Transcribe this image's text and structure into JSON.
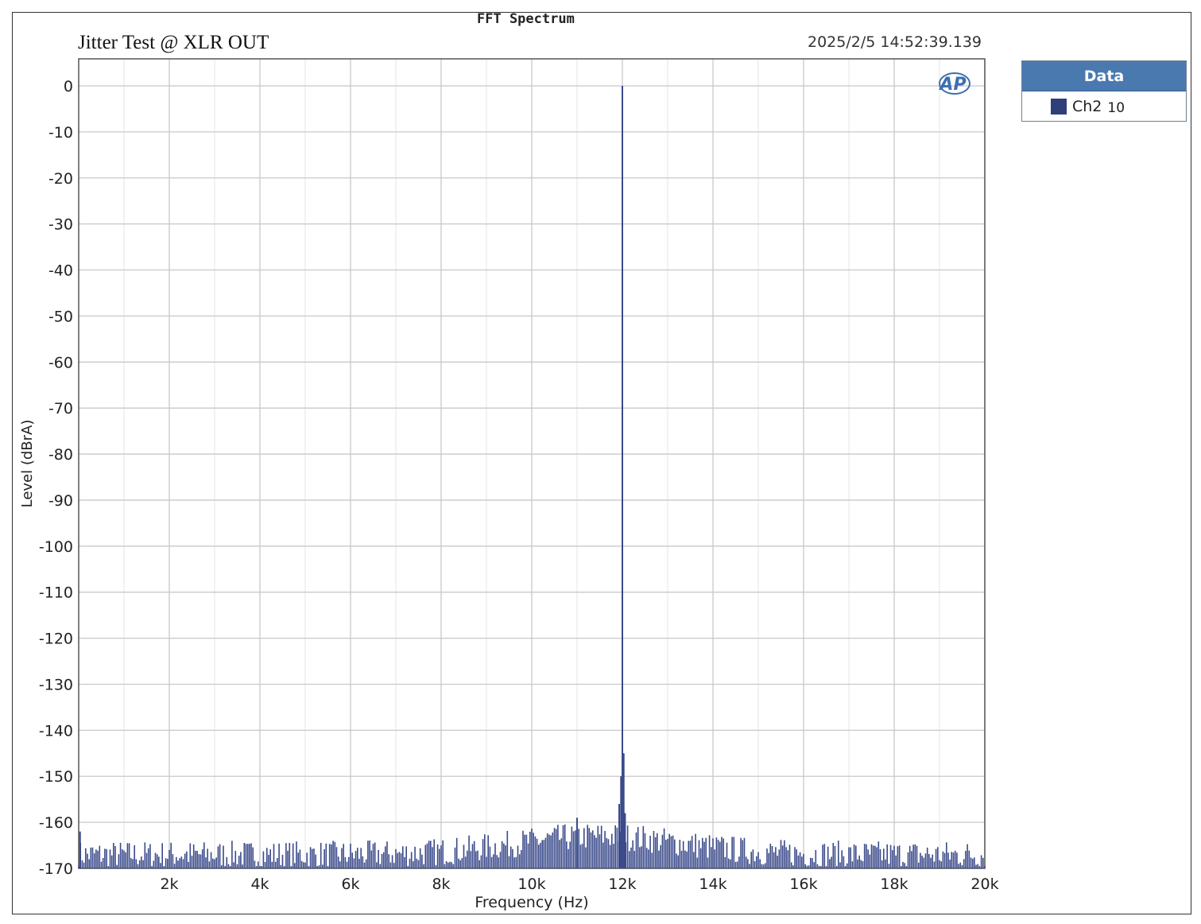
{
  "chart_data": {
    "type": "line",
    "header": "FFT Spectrum",
    "title": "Jitter Test @ XLR OUT",
    "timestamp": "2025/2/5 14:52:39.139",
    "xlabel": "Frequency (Hz)",
    "ylabel": "Level (dBrA)",
    "xlim": [
      0,
      20000
    ],
    "ylim": [
      -170,
      5
    ],
    "x_ticks": [
      {
        "value": 2000,
        "label": "2k"
      },
      {
        "value": 4000,
        "label": "4k"
      },
      {
        "value": 6000,
        "label": "6k"
      },
      {
        "value": 8000,
        "label": "8k"
      },
      {
        "value": 10000,
        "label": "10k"
      },
      {
        "value": 12000,
        "label": "12k"
      },
      {
        "value": 14000,
        "label": "14k"
      },
      {
        "value": 16000,
        "label": "16k"
      },
      {
        "value": 18000,
        "label": "18k"
      },
      {
        "value": 20000,
        "label": "20k"
      }
    ],
    "y_ticks": [
      {
        "value": 0,
        "label": "0"
      },
      {
        "value": -10,
        "label": "-10"
      },
      {
        "value": -20,
        "label": "-20"
      },
      {
        "value": -30,
        "label": "-30"
      },
      {
        "value": -40,
        "label": "-40"
      },
      {
        "value": -50,
        "label": "-50"
      },
      {
        "value": -60,
        "label": "-60"
      },
      {
        "value": -70,
        "label": "-70"
      },
      {
        "value": -80,
        "label": "-80"
      },
      {
        "value": -90,
        "label": "-90"
      },
      {
        "value": -100,
        "label": "-100"
      },
      {
        "value": -110,
        "label": "-110"
      },
      {
        "value": -120,
        "label": "-120"
      },
      {
        "value": -130,
        "label": "-130"
      },
      {
        "value": -140,
        "label": "-140"
      },
      {
        "value": -150,
        "label": "-150"
      },
      {
        "value": -160,
        "label": "-160"
      },
      {
        "value": -170,
        "label": "-170"
      }
    ],
    "grid": true,
    "minor_x_grid": true,
    "legend": {
      "header": "Data",
      "placement": "outside-right-top",
      "entries": [
        {
          "name": "Ch2",
          "extra": "10",
          "color": "#2f3f7a"
        }
      ]
    },
    "series": [
      {
        "name": "Ch2",
        "color": "#3a4a8a",
        "noise_floor_db": -167,
        "noise_spread_db": 3,
        "peaks": [
          {
            "x": 12000,
            "y": 0
          },
          {
            "x": 12030,
            "y": -145
          },
          {
            "x": 11970,
            "y": -150
          },
          {
            "x": 11930,
            "y": -156
          },
          {
            "x": 12060,
            "y": -158
          },
          {
            "x": 11000,
            "y": -159
          },
          {
            "x": 30,
            "y": -162
          }
        ]
      }
    ],
    "logo": "AP"
  }
}
